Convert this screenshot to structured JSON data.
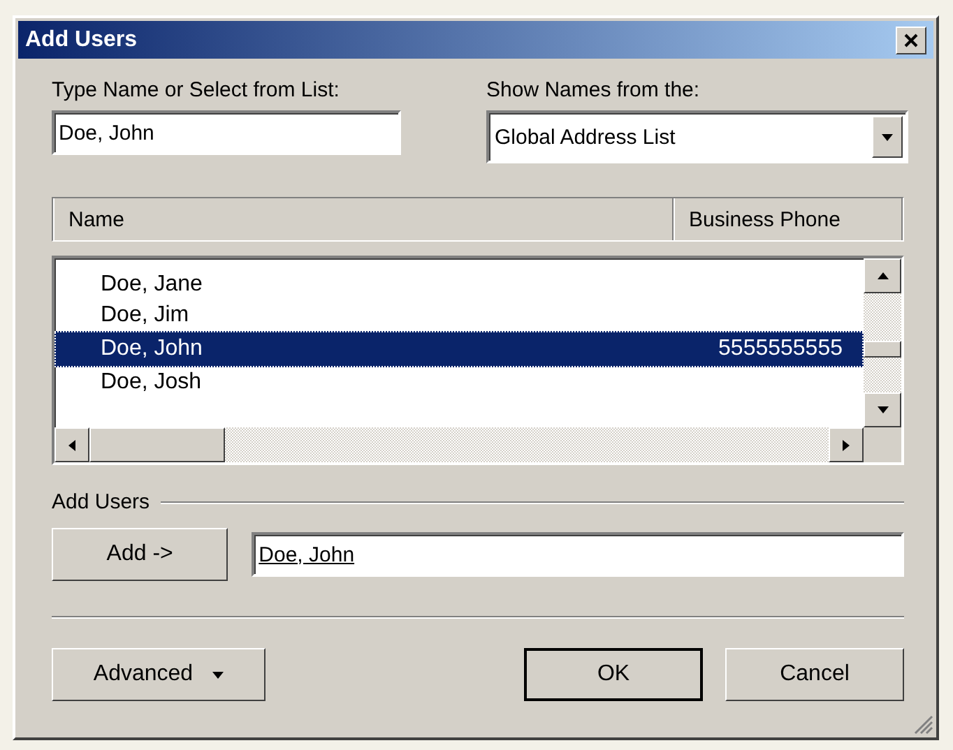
{
  "window": {
    "title": "Add Users"
  },
  "name_field": {
    "label": "Type Name or Select from List:",
    "value": "Doe, John"
  },
  "address_book": {
    "label": "Show Names from the:",
    "value": "Global Address List"
  },
  "table": {
    "columns": [
      "Name",
      "Business Phone"
    ],
    "rows": [
      {
        "name": "Doe, Jane",
        "selected": false
      },
      {
        "name": "Doe, Jim",
        "selected": false
      },
      {
        "name": "Doe, John",
        "phone": "5555555555",
        "selected": true
      },
      {
        "name": "Doe, Josh",
        "selected": false
      }
    ]
  },
  "add_users": {
    "label": "Add Users",
    "button": "Add ->",
    "value": "Doe, John"
  },
  "buttons": {
    "advanced": "Advanced",
    "ok": "OK",
    "cancel": "Cancel"
  }
}
